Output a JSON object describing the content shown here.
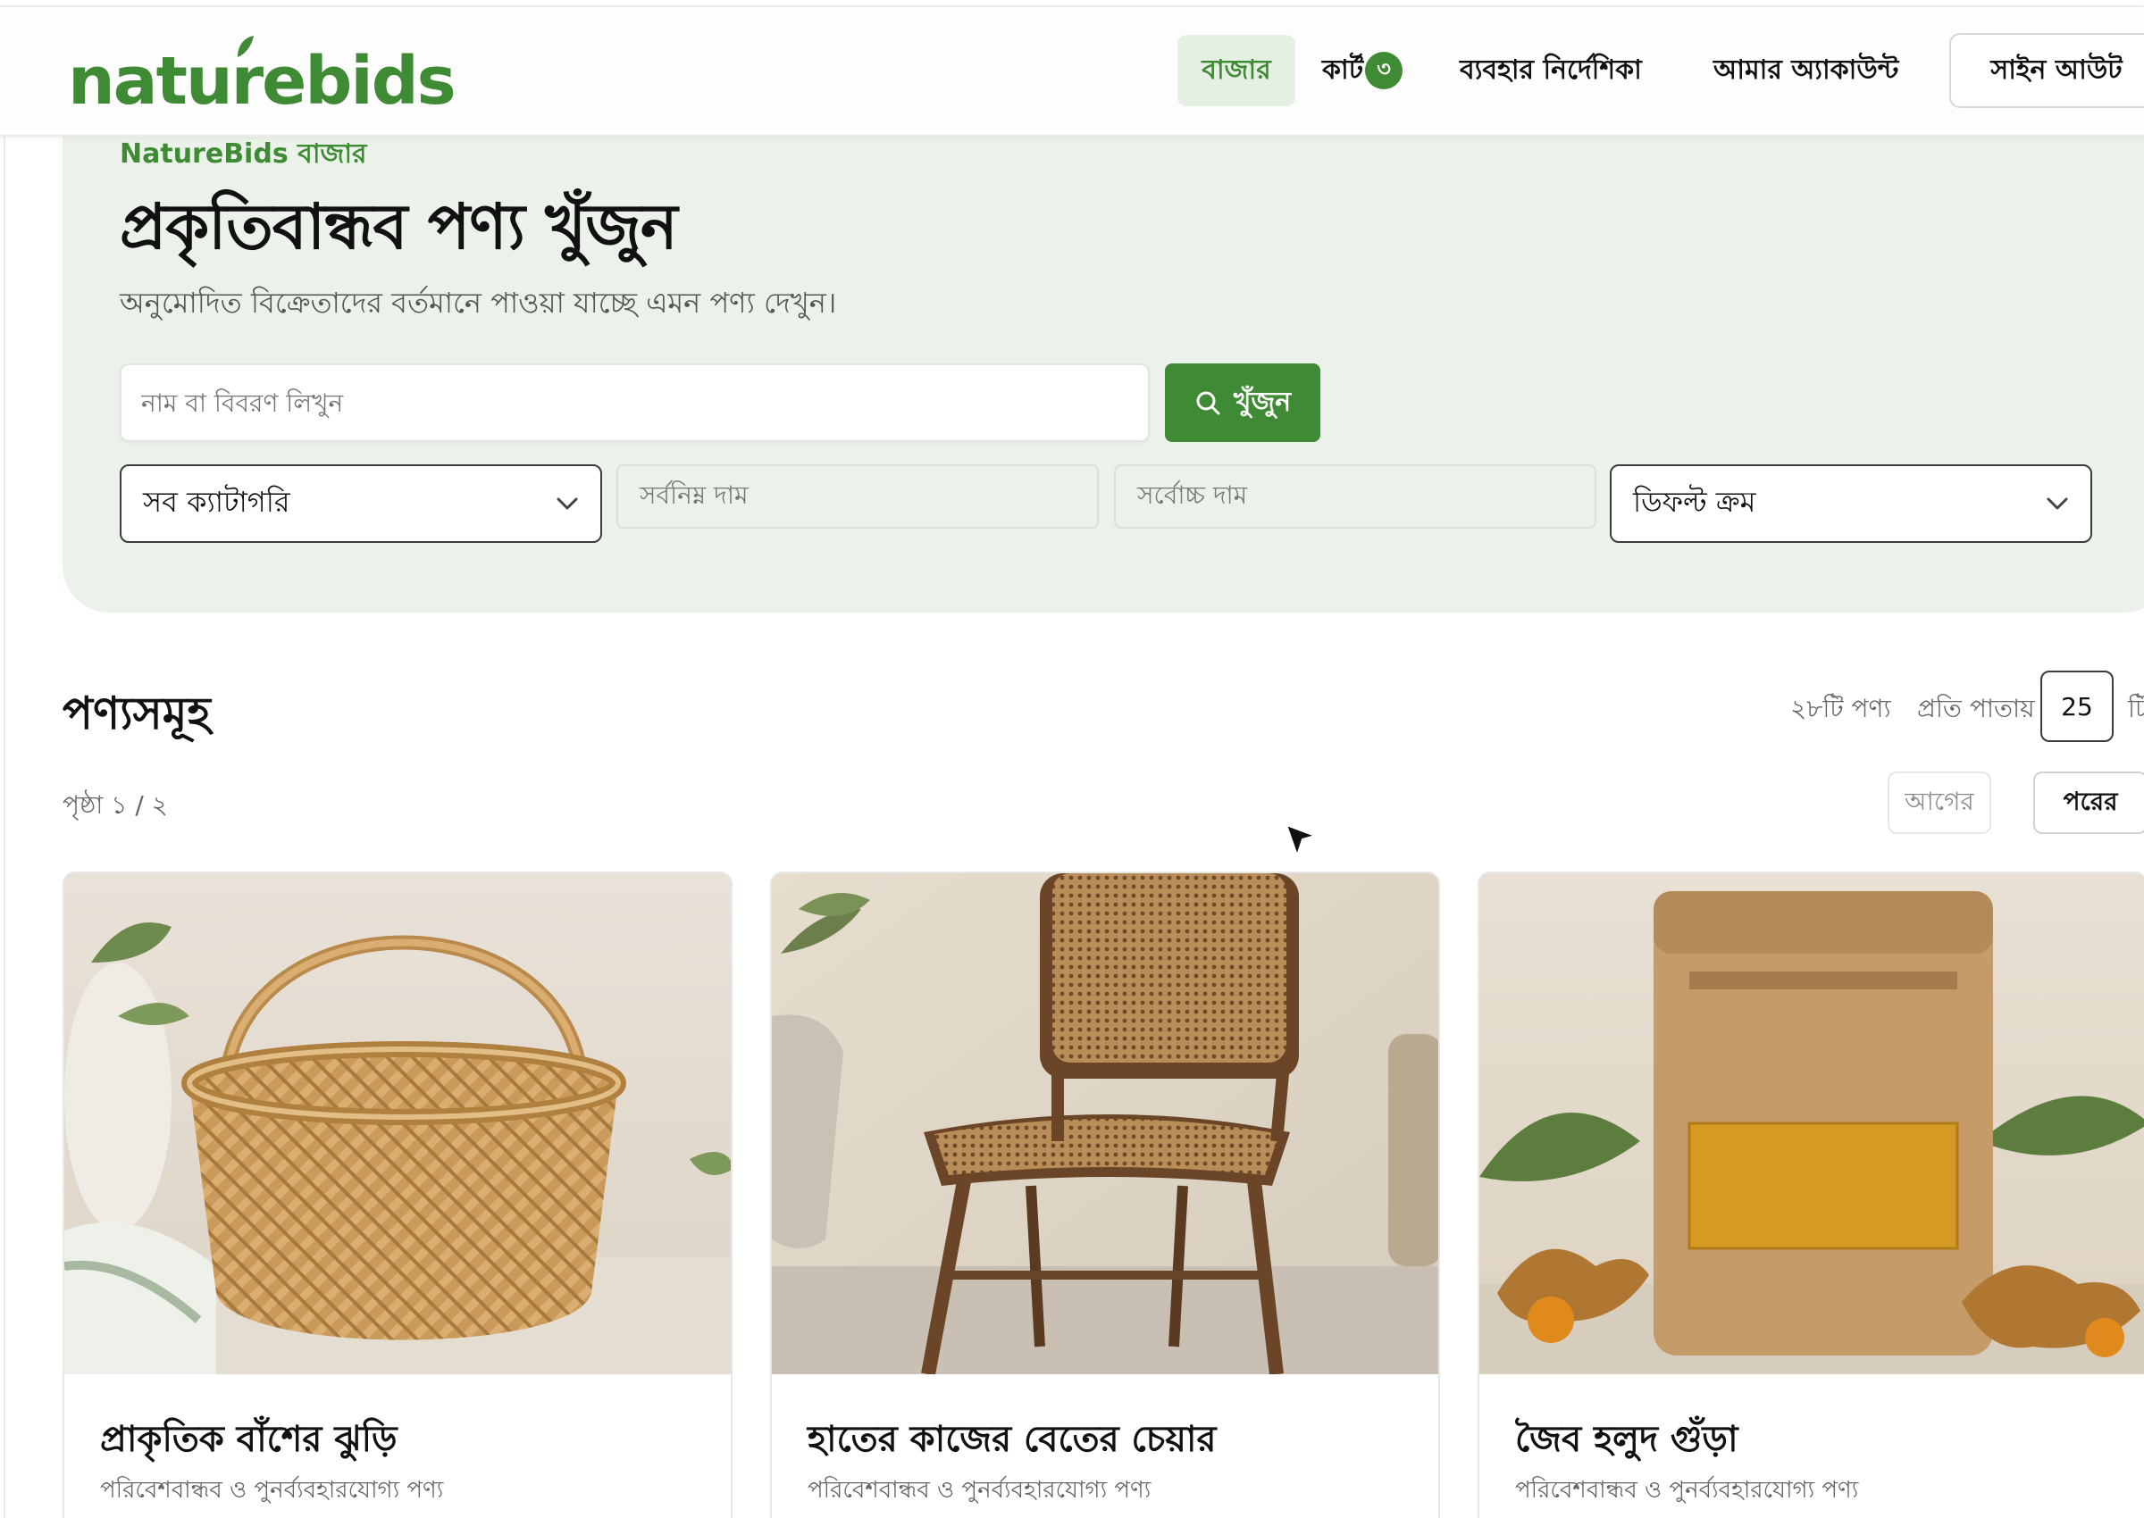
{
  "header": {
    "logo": "naturebids",
    "nav": {
      "market": "বাজার",
      "cart": "কার্ট",
      "cart_count": "৩",
      "guide": "ব্যবহার নির্দেশিকা",
      "account": "আমার অ্যাকাউন্ট"
    },
    "signout": "সাইন আউট"
  },
  "hero": {
    "eyebrow": "NatureBids বাজার",
    "title": "প্রকৃতিবান্ধব পণ্য খুঁজুন",
    "subtitle": "অনুমোদিত বিক্রেতাদের বর্তমানে পাওয়া যাচ্ছে এমন পণ্য দেখুন।",
    "search_placeholder": "নাম বা বিবরণ লিখুন",
    "search_value": "",
    "search_button": "খুঁজুন",
    "category_select": "সব ক্যাটাগরি",
    "min_price_placeholder": "সর্বনিম্ন দাম",
    "max_price_placeholder": "সর্বোচ্চ দাম",
    "sort_select": "ডিফল্ট ক্রম"
  },
  "products": {
    "title": "পণ্যসমূহ",
    "count": "২৮টি পণ্য",
    "per_page_label": "প্রতি পাতায়",
    "per_page_value": "25",
    "per_page_suffix": "টি",
    "page_indicator": "পৃষ্ঠা ১ / ২",
    "prev": "আগের",
    "next": "পরের",
    "items": [
      {
        "name": "প্রাকৃতিক বাঁশের ঝুড়ি",
        "desc": "পরিবেশবান্ধব ও পুনর্ব্যবহারযোগ্য পণ্য"
      },
      {
        "name": "হাতের কাজের বেতের চেয়ার",
        "desc": "পরিবেশবান্ধব ও পুনর্ব্যবহারযোগ্য পণ্য"
      },
      {
        "name": "জৈব হলুদ গুঁড়া",
        "desc": "পরিবেশবান্ধব ও পুনর্ব্যবহারযোগ্য পণ্য"
      }
    ]
  },
  "colors": {
    "brand": "#3f8a34",
    "hero_bg": "#ebf2ea"
  },
  "icons": [
    "leaf-icon",
    "search-icon",
    "chevron-down-icon",
    "mouse-cursor-icon"
  ]
}
